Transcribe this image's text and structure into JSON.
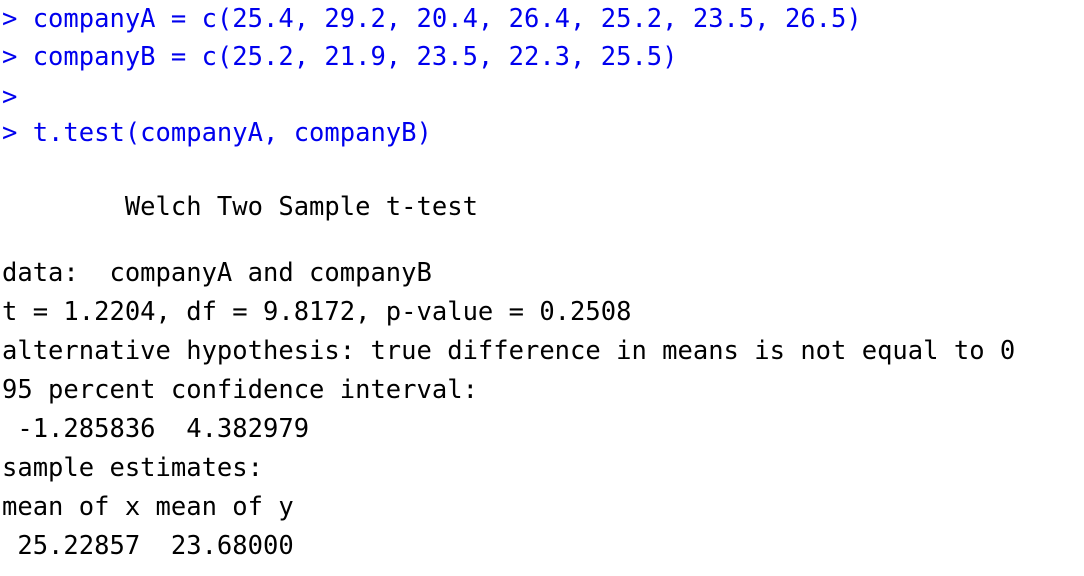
{
  "console": {
    "prompt_symbol": ">",
    "input_color": "#0000ee",
    "output_color": "#000000",
    "background_color": "#ffffff",
    "lines": [
      {
        "id": "input-companyA",
        "type": "input",
        "text": "> companyA = c(25.4, 29.2, 20.4, 26.4, 25.2, 23.5, 26.5)"
      },
      {
        "id": "input-companyB",
        "type": "input",
        "text": "> companyB = c(25.2, 21.9, 23.5, 22.3, 25.5)"
      },
      {
        "id": "prompt-empty",
        "type": "input",
        "text": ">"
      },
      {
        "id": "input-ttest",
        "type": "input",
        "text": "> t.test(companyA, companyB)"
      },
      {
        "id": "spacer-1",
        "type": "blank",
        "text": " "
      },
      {
        "id": "output-title",
        "type": "output",
        "text": "        Welch Two Sample t-test"
      },
      {
        "id": "spacer-2",
        "type": "blank",
        "text": " "
      },
      {
        "id": "output-data",
        "type": "output",
        "text": "data:  companyA and companyB"
      },
      {
        "id": "output-stats",
        "type": "output",
        "text": "t = 1.2204, df = 9.8172, p-value = 0.2508"
      },
      {
        "id": "output-alt",
        "type": "output",
        "text": "alternative hypothesis: true difference in means is not equal to 0"
      },
      {
        "id": "output-ci-label",
        "type": "output",
        "text": "95 percent confidence interval:"
      },
      {
        "id": "output-ci-values",
        "type": "output",
        "text": " -1.285836  4.382979"
      },
      {
        "id": "output-est-label",
        "type": "output",
        "text": "sample estimates:"
      },
      {
        "id": "output-mean-head",
        "type": "output",
        "text": "mean of x mean of y"
      },
      {
        "id": "output-mean-vals",
        "type": "output",
        "text": " 25.22857  23.68000"
      }
    ]
  },
  "statistics": {
    "test_name": "Welch Two Sample t-test",
    "data_label": "companyA and companyB",
    "t_statistic": "1.2204",
    "degrees_of_freedom": "9.8172",
    "p_value": "0.2508",
    "alternative_hypothesis": "true difference in means is not equal to 0",
    "confidence_level": "95 percent",
    "confidence_interval_lower": "-1.285836",
    "confidence_interval_upper": "4.382979",
    "mean_of_x": "25.22857",
    "mean_of_y": "23.68000",
    "sample_companyA": "25.4, 29.2, 20.4, 26.4, 25.2, 23.5, 26.5",
    "sample_companyB": "25.2, 21.9, 23.5, 22.3, 25.5"
  }
}
